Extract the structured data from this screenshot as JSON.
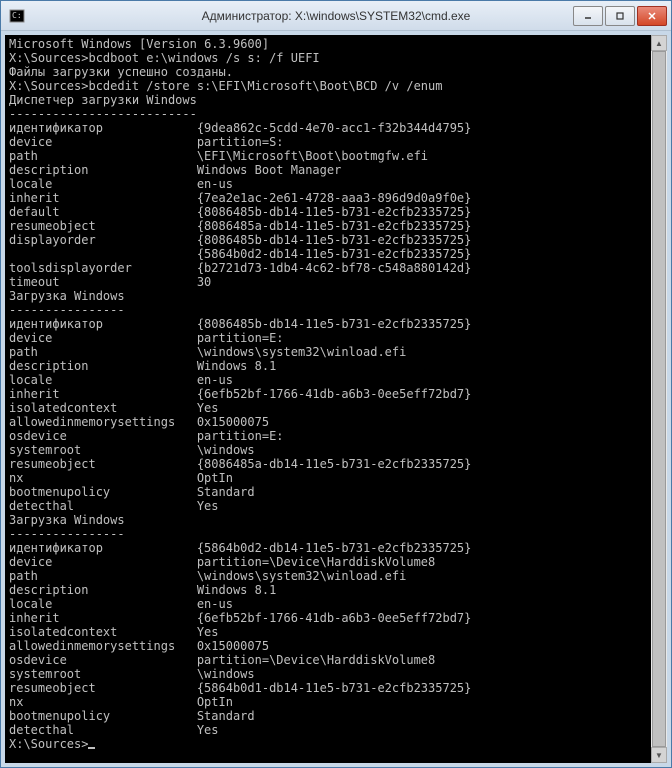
{
  "window": {
    "title": "Администратор: X:\\windows\\SYSTEM32\\cmd.exe"
  },
  "console": {
    "header": "Microsoft Windows [Version 6.3.9600]",
    "blank": "",
    "prompt1": "X:\\Sources>bcdboot e:\\windows /s s: /f UEFI",
    "result1": "Файлы загрузки успешно созданы.",
    "prompt2": "X:\\Sources>bcdedit /store s:\\EFI\\Microsoft\\Boot\\BCD /v /enum",
    "section1_title": "Диспетчер загрузки Windows",
    "section1_rule": "--------------------------",
    "section1": [
      [
        "идентификатор",
        "{9dea862c-5cdd-4e70-acc1-f32b344d4795}"
      ],
      [
        "device",
        "partition=S:"
      ],
      [
        "path",
        "\\EFI\\Microsoft\\Boot\\bootmgfw.efi"
      ],
      [
        "description",
        "Windows Boot Manager"
      ],
      [
        "locale",
        "en-us"
      ],
      [
        "inherit",
        "{7ea2e1ac-2e61-4728-aaa3-896d9d0a9f0e}"
      ],
      [
        "default",
        "{8086485b-db14-11e5-b731-e2cfb2335725}"
      ],
      [
        "resumeobject",
        "{8086485a-db14-11e5-b731-e2cfb2335725}"
      ],
      [
        "displayorder",
        "{8086485b-db14-11e5-b731-e2cfb2335725}"
      ],
      [
        "",
        "{5864b0d2-db14-11e5-b731-e2cfb2335725}"
      ],
      [
        "toolsdisplayorder",
        "{b2721d73-1db4-4c62-bf78-c548a880142d}"
      ],
      [
        "timeout",
        "30"
      ]
    ],
    "section2_title": "Загрузка Windows",
    "section2_rule": "----------------",
    "section2": [
      [
        "идентификатор",
        "{8086485b-db14-11e5-b731-e2cfb2335725}"
      ],
      [
        "device",
        "partition=E:"
      ],
      [
        "path",
        "\\windows\\system32\\winload.efi"
      ],
      [
        "description",
        "Windows 8.1"
      ],
      [
        "locale",
        "en-us"
      ],
      [
        "inherit",
        "{6efb52bf-1766-41db-a6b3-0ee5eff72bd7}"
      ],
      [
        "isolatedcontext",
        "Yes"
      ],
      [
        "allowedinmemorysettings",
        "0x15000075"
      ],
      [
        "osdevice",
        "partition=E:"
      ],
      [
        "systemroot",
        "\\windows"
      ],
      [
        "resumeobject",
        "{8086485a-db14-11e5-b731-e2cfb2335725}"
      ],
      [
        "nx",
        "OptIn"
      ],
      [
        "bootmenupolicy",
        "Standard"
      ],
      [
        "detecthal",
        "Yes"
      ]
    ],
    "section3_title": "Загрузка Windows",
    "section3_rule": "----------------",
    "section3": [
      [
        "идентификатор",
        "{5864b0d2-db14-11e5-b731-e2cfb2335725}"
      ],
      [
        "device",
        "partition=\\Device\\HarddiskVolume8"
      ],
      [
        "path",
        "\\windows\\system32\\winload.efi"
      ],
      [
        "description",
        "Windows 8.1"
      ],
      [
        "locale",
        "en-us"
      ],
      [
        "inherit",
        "{6efb52bf-1766-41db-a6b3-0ee5eff72bd7}"
      ],
      [
        "isolatedcontext",
        "Yes"
      ],
      [
        "allowedinmemorysettings",
        "0x15000075"
      ],
      [
        "osdevice",
        "partition=\\Device\\HarddiskVolume8"
      ],
      [
        "systemroot",
        "\\windows"
      ],
      [
        "resumeobject",
        "{5864b0d1-db14-11e5-b731-e2cfb2335725}"
      ],
      [
        "nx",
        "OptIn"
      ],
      [
        "bootmenupolicy",
        "Standard"
      ],
      [
        "detecthal",
        "Yes"
      ]
    ],
    "prompt3": "X:\\Sources>"
  }
}
